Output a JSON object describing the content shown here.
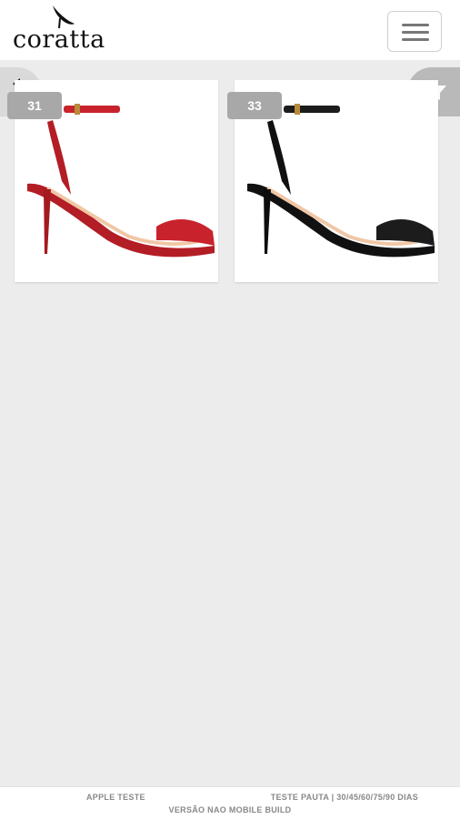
{
  "header": {
    "logo_text": "coratta",
    "menu_icon": "hamburger-menu-icon"
  },
  "actions": {
    "back_icon": "undo-arrow-icon",
    "filter_icon": "funnel-filter-icon"
  },
  "products": [
    {
      "size": "31",
      "color_name": "red",
      "color": "#c8232c"
    },
    {
      "size": "33",
      "color_name": "black",
      "color": "#1c1c1c"
    }
  ],
  "footer": {
    "left": "APPLE TESTE",
    "right": "TESTE PAUTA | 30/45/60/75/90 DIAS",
    "center": "VERSÃO NAO MOBILE BUILD"
  },
  "colors": {
    "background": "#ececec",
    "badge": "#a8a8a8",
    "filter_button": "#b9b9b9"
  }
}
